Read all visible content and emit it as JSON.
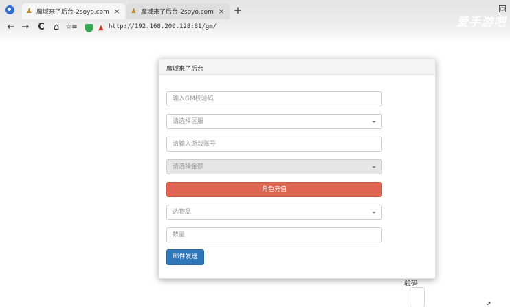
{
  "browser": {
    "tabs": [
      {
        "title": "魔域来了后台-2soyo.com",
        "close": "×"
      },
      {
        "title": "魔域来了后台-2soyo.com",
        "close": "×"
      }
    ],
    "new_tab": "+",
    "window_control": "▢",
    "watermark": "爱手游吧",
    "nav": {
      "back": "←",
      "forward": "→",
      "reload": "C",
      "home": "⌂",
      "reading_list": "☆≡"
    },
    "url": "http://192.168.200.128:81/gm/"
  },
  "background": {
    "partial_text": "验码",
    "corner_mark": "↗"
  },
  "modal": {
    "title": "魔域来了后台",
    "gm_code_placeholder": "输入GM校验码",
    "server_select": "请选择区服",
    "account_placeholder": "请输入游戏账号",
    "amount_select": "请选择金额",
    "recharge_button": "角色充值",
    "item_select": "选物品",
    "quantity_placeholder": "数量",
    "send_mail_button": "邮件发送"
  },
  "colors": {
    "danger": "#e06452",
    "primary": "#2f76b8",
    "disabled_field": "#e6e6e6"
  }
}
